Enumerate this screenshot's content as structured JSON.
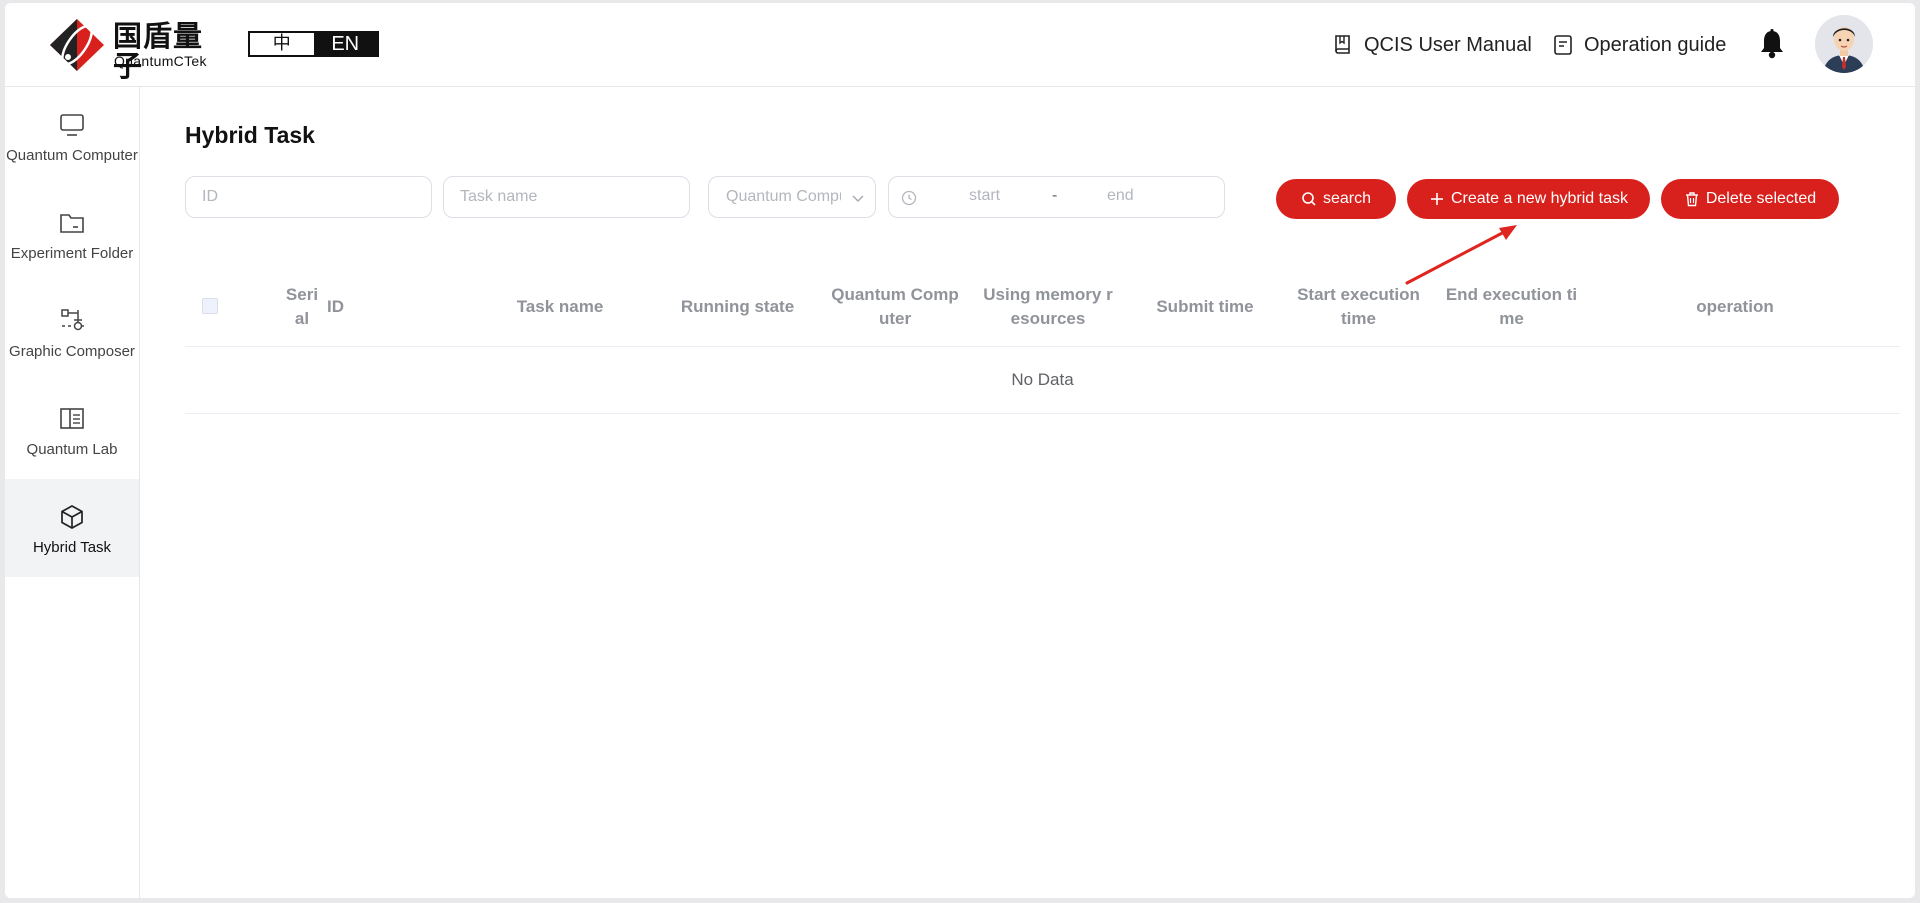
{
  "header": {
    "logo_cn": "国盾量子",
    "logo_en": "QuantumCTek",
    "lang_zh": "中",
    "lang_en": "EN",
    "manual_label": "QCIS User Manual",
    "guide_label": "Operation guide"
  },
  "sidebar": {
    "items": [
      {
        "label": "Quantum Computer",
        "icon": "monitor-icon"
      },
      {
        "label": "Experiment Folder",
        "icon": "folder-icon"
      },
      {
        "label": "Graphic Composer",
        "icon": "circuit-icon"
      },
      {
        "label": "Quantum Lab",
        "icon": "book-icon"
      },
      {
        "label": "Hybrid Task",
        "icon": "cube-icon",
        "active": true
      }
    ]
  },
  "main": {
    "title": "Hybrid Task",
    "filters": {
      "id_placeholder": "ID",
      "task_name_placeholder": "Task name",
      "computer_placeholder": "Quantum Computer",
      "date_start": "start",
      "date_sep": "-",
      "date_end": "end"
    },
    "buttons": {
      "search": "search",
      "create": "Create a new hybrid task",
      "delete": "Delete selected"
    },
    "table": {
      "columns": [
        "Seri\nal",
        "ID",
        "Task name",
        "Running state",
        "Quantum Comp\nuter",
        "Using memory r\nesources",
        "Submit time",
        "Start execution\ntime",
        "End execution ti\nme",
        "operation"
      ],
      "empty_text": "No Data"
    }
  },
  "colors": {
    "accent": "#d8211d",
    "header_text": "#909399",
    "active_bg": "#f2f3f5"
  }
}
